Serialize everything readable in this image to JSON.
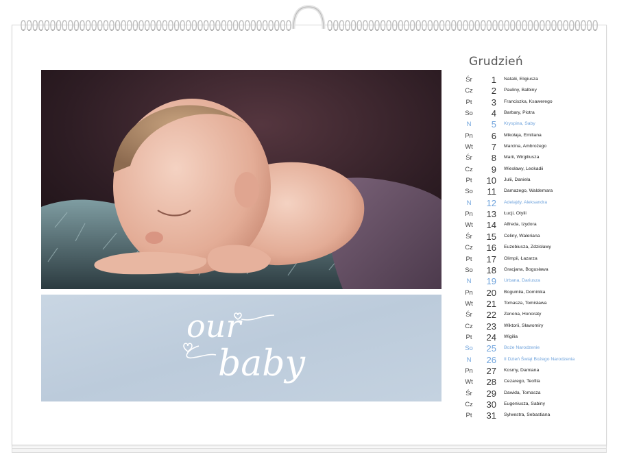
{
  "accent_color": "#6fa3dc",
  "panel_color": "#bfcfdf",
  "photo": {
    "icon": "sleeping-baby-photo"
  },
  "tagline": {
    "line1": "our",
    "line2": "baby"
  },
  "calendar": {
    "month": "Grudzień",
    "days": [
      {
        "dow": "Śr",
        "num": "1",
        "names": "Natalii, Eligiusza",
        "sunday": false
      },
      {
        "dow": "Cz",
        "num": "2",
        "names": "Pauliny, Balbiny",
        "sunday": false
      },
      {
        "dow": "Pt",
        "num": "3",
        "names": "Franciszka, Ksawerego",
        "sunday": false
      },
      {
        "dow": "So",
        "num": "4",
        "names": "Barbary, Piotra",
        "sunday": false
      },
      {
        "dow": "N",
        "num": "5",
        "names": "Kryspina, Saby",
        "sunday": true
      },
      {
        "dow": "Pn",
        "num": "6",
        "names": "Mikołaja, Emiliana",
        "sunday": false
      },
      {
        "dow": "Wt",
        "num": "7",
        "names": "Marcina, Ambrożego",
        "sunday": false
      },
      {
        "dow": "Śr",
        "num": "8",
        "names": "Marii, Wirgiliusza",
        "sunday": false
      },
      {
        "dow": "Cz",
        "num": "9",
        "names": "Wiesławy, Leokadii",
        "sunday": false
      },
      {
        "dow": "Pt",
        "num": "10",
        "names": "Julii, Daniela",
        "sunday": false
      },
      {
        "dow": "So",
        "num": "11",
        "names": "Damazego, Waldemara",
        "sunday": false
      },
      {
        "dow": "N",
        "num": "12",
        "names": "Adelajdy, Aleksandra",
        "sunday": true
      },
      {
        "dow": "Pn",
        "num": "13",
        "names": "Łucji, Otylii",
        "sunday": false
      },
      {
        "dow": "Wt",
        "num": "14",
        "names": "Alfreda, Izydora",
        "sunday": false
      },
      {
        "dow": "Śr",
        "num": "15",
        "names": "Celiny, Waleriana",
        "sunday": false
      },
      {
        "dow": "Cz",
        "num": "16",
        "names": "Euzebiusza, Zdzisławy",
        "sunday": false
      },
      {
        "dow": "Pt",
        "num": "17",
        "names": "Olimpii, Łazarza",
        "sunday": false
      },
      {
        "dow": "So",
        "num": "18",
        "names": "Gracjana, Bogusława",
        "sunday": false
      },
      {
        "dow": "N",
        "num": "19",
        "names": "Urbana, Dariusza",
        "sunday": true
      },
      {
        "dow": "Pn",
        "num": "20",
        "names": "Bogumiła, Dominika",
        "sunday": false
      },
      {
        "dow": "Wt",
        "num": "21",
        "names": "Tomasza, Tomisława",
        "sunday": false
      },
      {
        "dow": "Śr",
        "num": "22",
        "names": "Zenona, Honoraty",
        "sunday": false
      },
      {
        "dow": "Cz",
        "num": "23",
        "names": "Wiktorii, Sławomiry",
        "sunday": false
      },
      {
        "dow": "Pt",
        "num": "24",
        "names": "Wigilia",
        "sunday": false
      },
      {
        "dow": "So",
        "num": "25",
        "names": "Boże Narodzenie",
        "sunday": true
      },
      {
        "dow": "N",
        "num": "26",
        "names": "II Dzień Świąt Bożego Narodzenia",
        "sunday": true
      },
      {
        "dow": "Pn",
        "num": "27",
        "names": "Kosmy, Damiana",
        "sunday": false
      },
      {
        "dow": "Wt",
        "num": "28",
        "names": "Cezarego, Teofila",
        "sunday": false
      },
      {
        "dow": "Śr",
        "num": "29",
        "names": "Dawida, Tomasza",
        "sunday": false
      },
      {
        "dow": "Cz",
        "num": "30",
        "names": "Eugeniusza, Sabiny",
        "sunday": false
      },
      {
        "dow": "Pt",
        "num": "31",
        "names": "Sylwestra, Sebastiana",
        "sunday": false
      }
    ]
  }
}
